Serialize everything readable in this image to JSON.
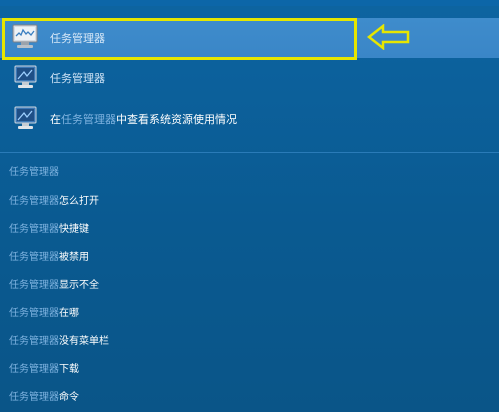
{
  "best_match": {
    "label": "任务管理器"
  },
  "apps": [
    {
      "label": "任务管理器"
    },
    {
      "prefix": "在",
      "query": "任务管理器",
      "suffix": "中查看系统资源使用情况"
    }
  ],
  "web_suggestions": {
    "query": "任务管理器",
    "items": [
      {
        "suffix": ""
      },
      {
        "suffix": "怎么打开"
      },
      {
        "suffix": "快捷键"
      },
      {
        "suffix": "被禁用"
      },
      {
        "suffix": "显示不全"
      },
      {
        "suffix": "在哪"
      },
      {
        "suffix": "没有菜单栏"
      },
      {
        "suffix": "下载"
      },
      {
        "suffix": "命令"
      }
    ]
  },
  "colors": {
    "background": "#0b5a92",
    "selected": "#3f8ccc",
    "highlight_box": "#e6e600",
    "query_text": "#7fb3e0"
  },
  "icons": [
    "task-manager-monitor-icon",
    "arrow-left-icon"
  ]
}
